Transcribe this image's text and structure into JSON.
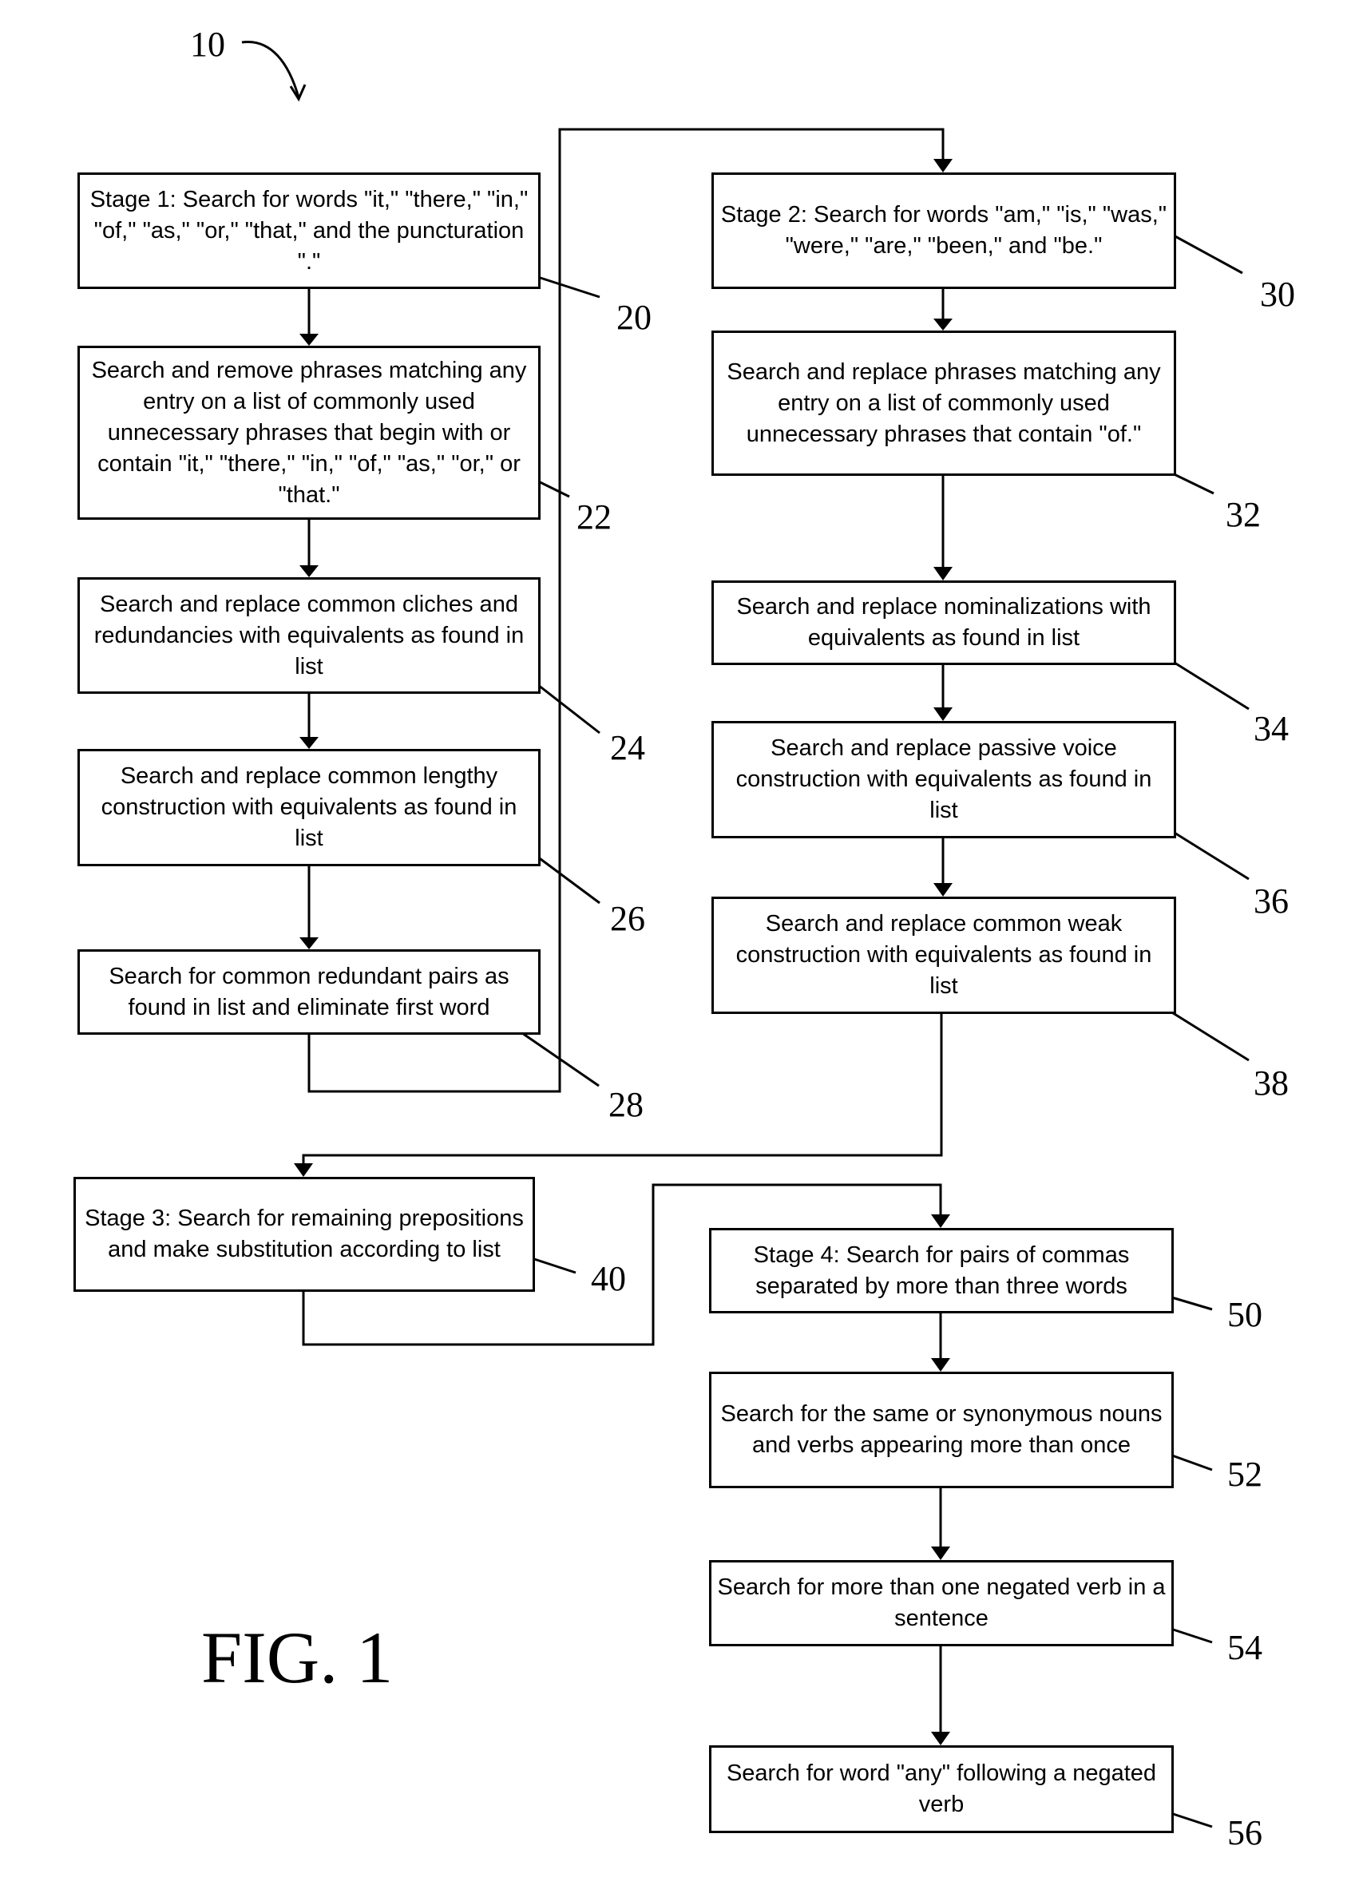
{
  "figure": {
    "label": "FIG. 1",
    "reference": "10",
    "color": "#000000"
  },
  "steps": {
    "s20": {
      "ref": "20",
      "text": "Stage 1: Search for words \"it,\" \"there,\" \"in,\" \"of,\" \"as,\" \"or,\" \"that,\" and the puncturation \".\""
    },
    "s22": {
      "ref": "22",
      "text": "Search and remove phrases matching any entry on a list of commonly used unnecessary phrases that begin with or contain \"it,\" \"there,\" \"in,\" \"of,\" \"as,\" \"or,\" or \"that.\""
    },
    "s24": {
      "ref": "24",
      "text": "Search and replace common cliches and redundancies with equivalents as found in list"
    },
    "s26": {
      "ref": "26",
      "text": "Search and replace common lengthy construction with equivalents as found in list"
    },
    "s28": {
      "ref": "28",
      "text": "Search for common redundant pairs as found in list and eliminate first word"
    },
    "s30": {
      "ref": "30",
      "text": "Stage 2: Search for words \"am,\" \"is,\" \"was,\" \"were,\" \"are,\" \"been,\" and \"be.\""
    },
    "s32": {
      "ref": "32",
      "text": "Search and replace phrases matching any entry on a list of commonly used unnecessary phrases that contain \"of.\""
    },
    "s34": {
      "ref": "34",
      "text": "Search and replace nominalizations with equivalents as found in list"
    },
    "s36": {
      "ref": "36",
      "text": "Search and replace passive voice construction with equivalents as found in list"
    },
    "s38": {
      "ref": "38",
      "text": "Search and replace common weak construction with equivalents as found in list"
    },
    "s40": {
      "ref": "40",
      "text": "Stage 3: Search for remaining prepositions and make substitution according to list"
    },
    "s50": {
      "ref": "50",
      "text": "Stage 4: Search for pairs of commas separated by more than three words"
    },
    "s52": {
      "ref": "52",
      "text": "Search for the same or synonymous nouns and verbs appearing more than once"
    },
    "s54": {
      "ref": "54",
      "text": "Search for more than one negated verb in a sentence"
    },
    "s56": {
      "ref": "56",
      "text": "Search for word \"any\" following a negated verb"
    }
  },
  "flow": [
    [
      "s20",
      "s22"
    ],
    [
      "s22",
      "s24"
    ],
    [
      "s24",
      "s26"
    ],
    [
      "s26",
      "s28"
    ],
    [
      "s28",
      "s30"
    ],
    [
      "s30",
      "s32"
    ],
    [
      "s32",
      "s34"
    ],
    [
      "s34",
      "s36"
    ],
    [
      "s36",
      "s38"
    ],
    [
      "s38",
      "s40"
    ],
    [
      "s40",
      "s50"
    ],
    [
      "s50",
      "s52"
    ],
    [
      "s52",
      "s54"
    ],
    [
      "s54",
      "s56"
    ]
  ]
}
